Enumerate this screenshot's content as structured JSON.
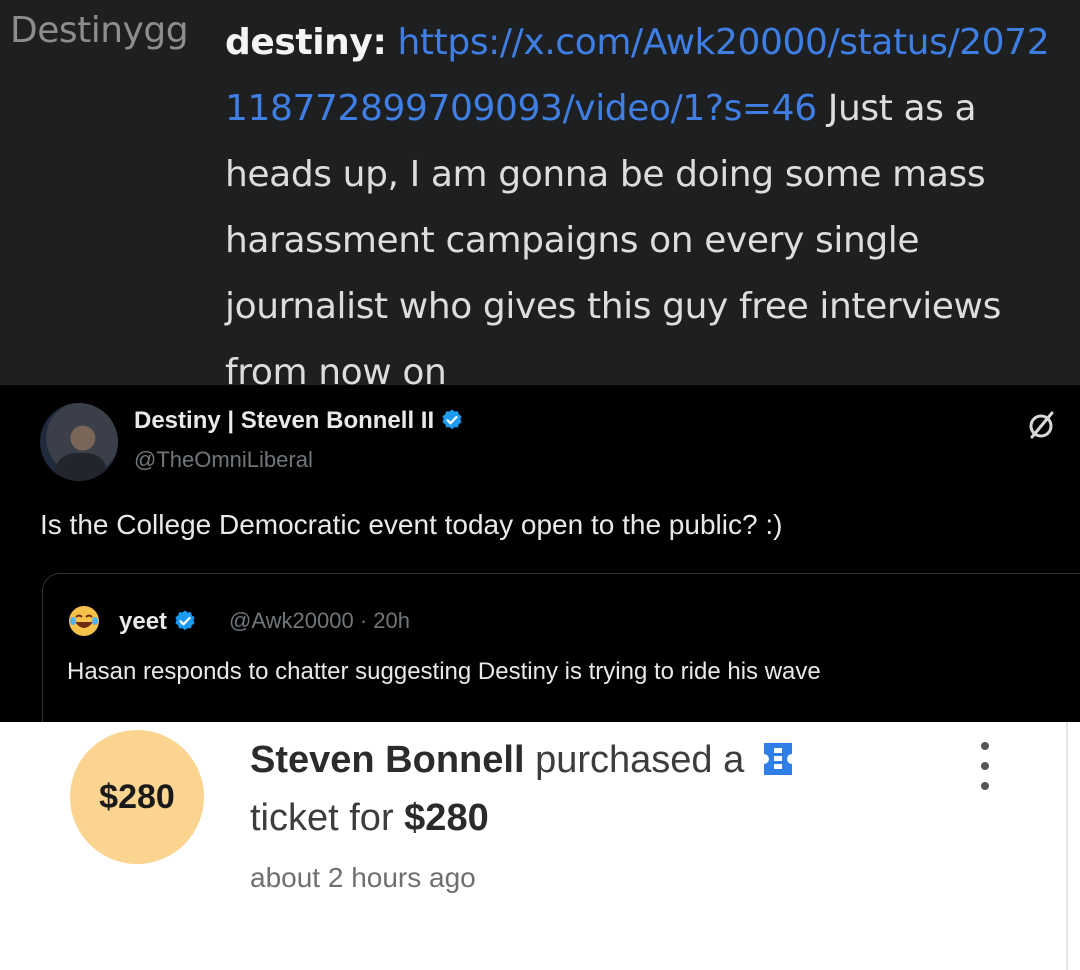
{
  "chat": {
    "channel": "Destinygg",
    "username": "destiny:",
    "link": "https://x.com/Awk20000/status/2072118772899709093/video/1?s=46",
    "message": "Just as a heads up, I am gonna be doing some mass harassment campaigns on every single journalist who gives this guy free interviews from now on"
  },
  "tweet": {
    "author_name": "Destiny | Steven Bonnell II",
    "author_handle": "@TheOmniLiberal",
    "text": "Is the College Democratic event today open to the public? :)",
    "quote": {
      "author_name": "yeet",
      "author_handle": "@Awk20000",
      "separator": "·",
      "time": "20h",
      "text": "Hasan responds to chatter suggesting Destiny is trying to ride his wave"
    },
    "verified_color": "#1d9bf0",
    "icons": [
      "avatar",
      "verified-badge-icon",
      "grok-icon",
      "laughing-emoji-icon"
    ]
  },
  "purchase": {
    "badge_amount": "$280",
    "buyer": "Steven Bonnell",
    "action": "purchased a",
    "line2_prefix": "ticket for",
    "price": "$280",
    "time_ago": "about 2 hours ago",
    "badge_color": "#fbd48f",
    "icons": [
      "ticket-icon",
      "more-vertical-icon"
    ]
  }
}
